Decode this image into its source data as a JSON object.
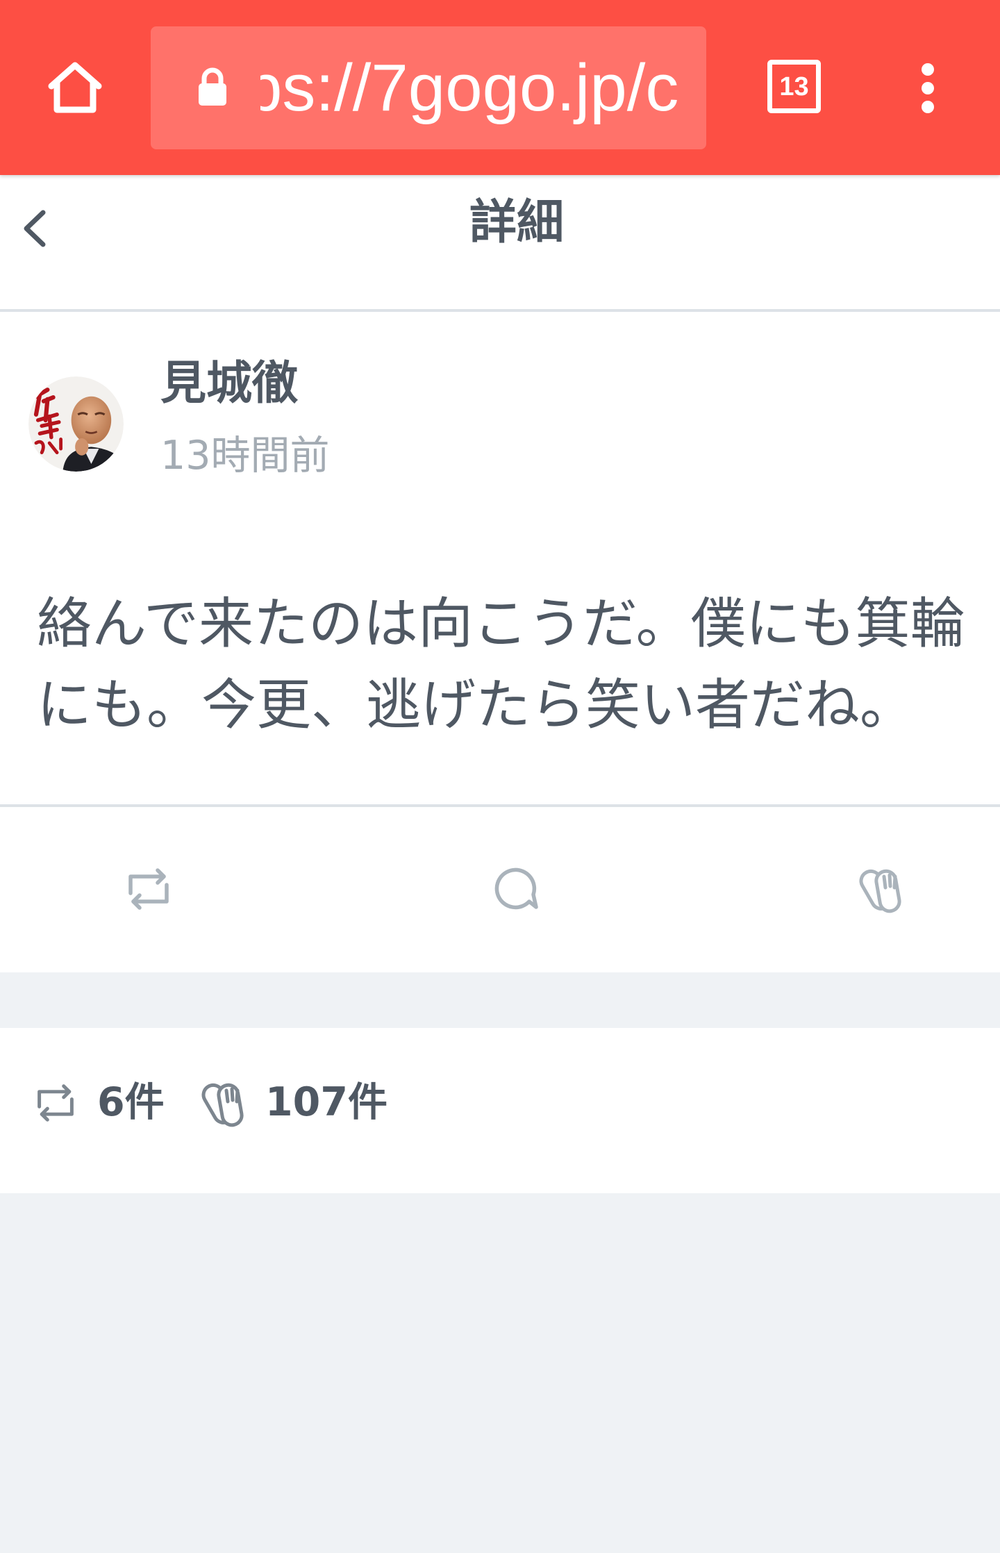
{
  "browser": {
    "url": "ps://7gogo.jp/c",
    "tab_count": "13",
    "icons": [
      "home-icon",
      "lock-icon",
      "tab-switcher-icon",
      "overflow-menu-icon"
    ]
  },
  "header": {
    "title": "詳細",
    "back_icon": "chevron-left-icon"
  },
  "post": {
    "author": "見城徹",
    "time": "13時間前",
    "body": "絡んで来たのは向こうだ。僕にも箕輪にも。今更、逃げたら笑い者だね。"
  },
  "actions": [
    {
      "icon": "repost-icon"
    },
    {
      "icon": "comment-icon"
    },
    {
      "icon": "clap-icon"
    }
  ],
  "stats": {
    "reposts": "6件",
    "claps": "107件"
  },
  "colors": {
    "toolbar": "#fd4f44",
    "url_bar": "#ff726a",
    "text": "#4f5863",
    "muted_text": "#a3abb3",
    "divider": "#dde2e7",
    "background": "#eff2f5"
  }
}
